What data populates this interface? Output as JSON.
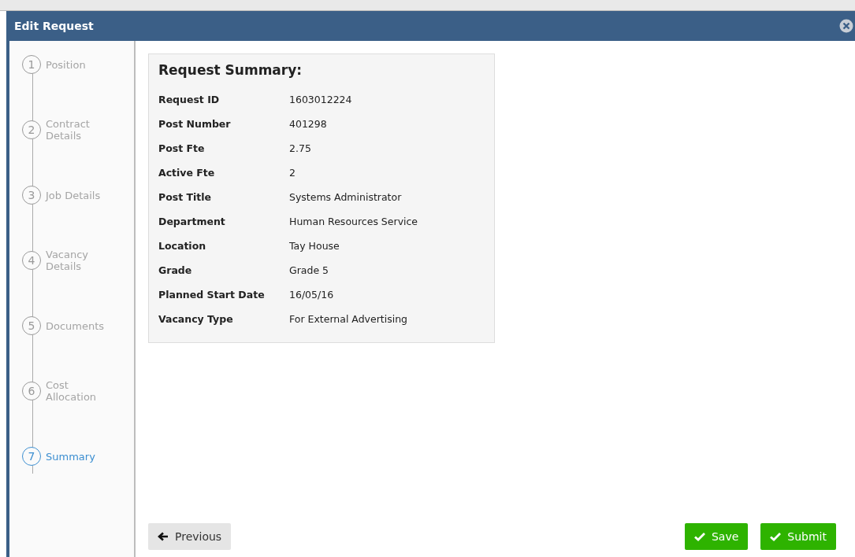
{
  "window": {
    "title": "Edit Request"
  },
  "steps": [
    {
      "number": "1",
      "label": "Position",
      "selected": false
    },
    {
      "number": "2",
      "label": "Contract Details",
      "selected": false
    },
    {
      "number": "3",
      "label": "Job Details",
      "selected": false
    },
    {
      "number": "4",
      "label": "Vacancy Details",
      "selected": false
    },
    {
      "number": "5",
      "label": "Documents",
      "selected": false
    },
    {
      "number": "6",
      "label": "Cost Allocation",
      "selected": false
    },
    {
      "number": "7",
      "label": "Summary",
      "selected": true
    }
  ],
  "summary": {
    "title": "Request Summary:",
    "rows": [
      {
        "label": "Request ID",
        "value": "1603012224"
      },
      {
        "label": "Post Number",
        "value": "401298"
      },
      {
        "label": "Post Fte",
        "value": "2.75"
      },
      {
        "label": "Active Fte",
        "value": "2"
      },
      {
        "label": "Post Title",
        "value": "Systems Administrator"
      },
      {
        "label": "Department",
        "value": "Human Resources Service"
      },
      {
        "label": "Location",
        "value": "Tay House"
      },
      {
        "label": "Grade",
        "value": "Grade 5"
      },
      {
        "label": "Planned Start Date",
        "value": "16/05/16"
      },
      {
        "label": "Vacancy Type",
        "value": "For External Advertising"
      }
    ]
  },
  "buttons": {
    "previous": "Previous",
    "save": "Save",
    "submit": "Submit"
  }
}
